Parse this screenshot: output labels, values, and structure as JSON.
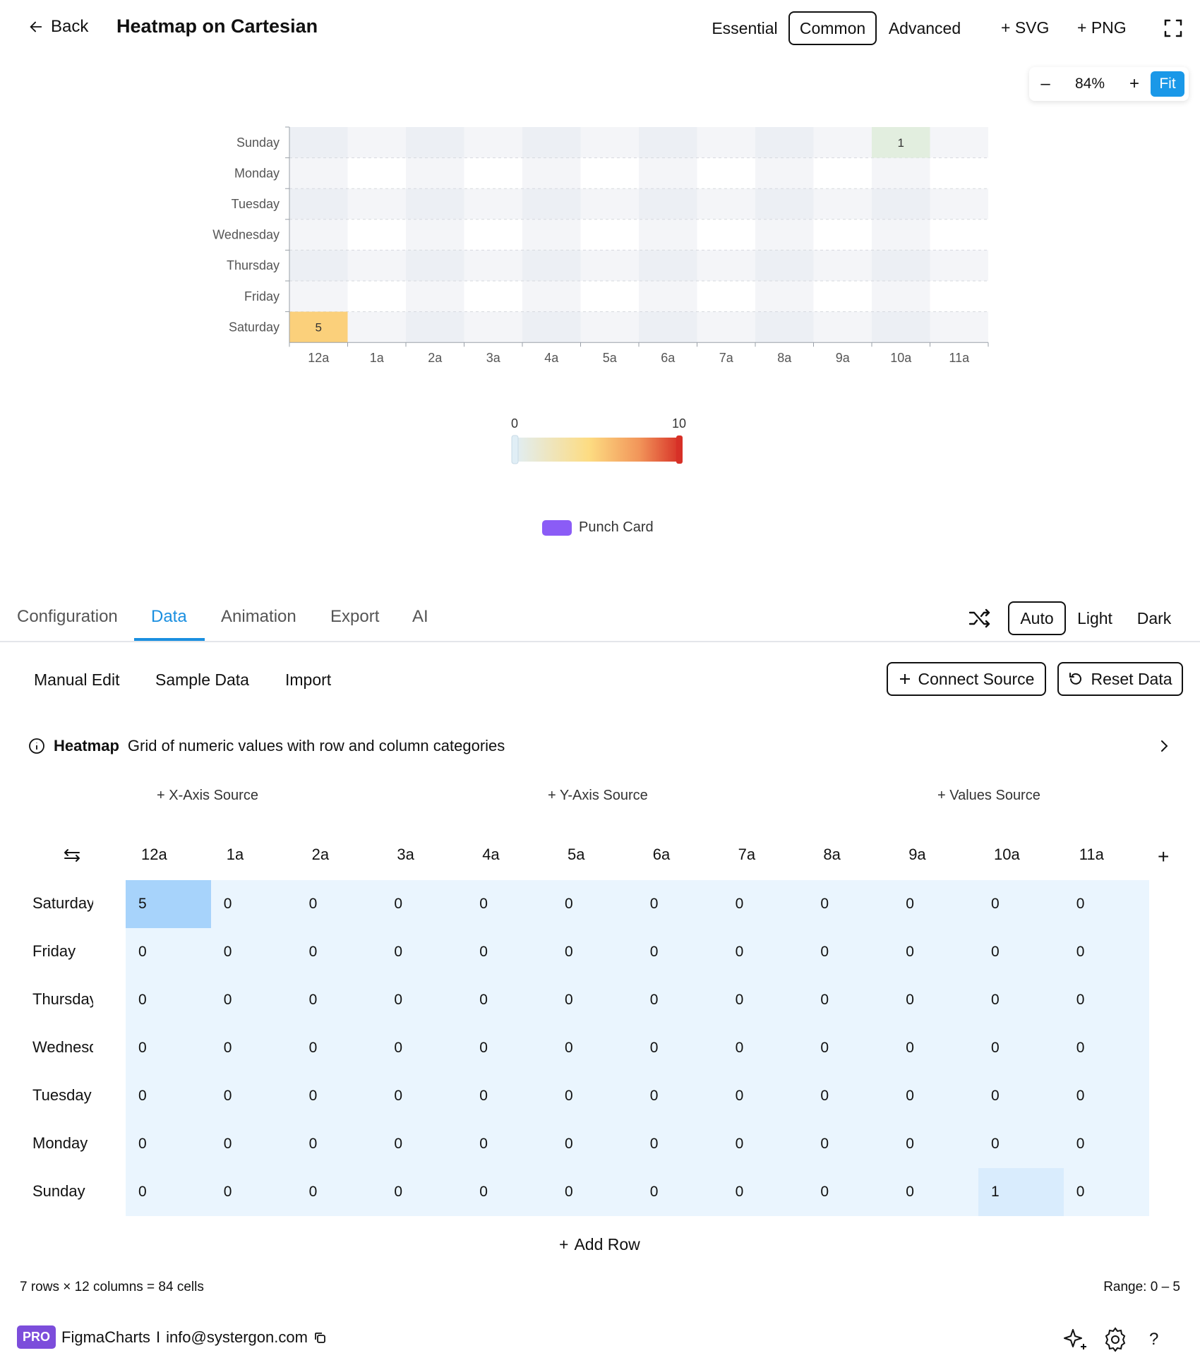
{
  "header": {
    "back_label": "Back",
    "title": "Heatmap on Cartesian",
    "levels": [
      "Essential",
      "Common",
      "Advanced"
    ],
    "active_level": "Common",
    "export_svg": "+ SVG",
    "export_png": "+ PNG"
  },
  "zoom": {
    "minus": "–",
    "value": "84%",
    "plus": "+",
    "fit_label": "Fit"
  },
  "chart_data": {
    "type": "heatmap",
    "x_categories": [
      "12a",
      "1a",
      "2a",
      "3a",
      "4a",
      "5a",
      "6a",
      "7a",
      "8a",
      "9a",
      "10a",
      "11a"
    ],
    "y_categories": [
      "Sunday",
      "Monday",
      "Tuesday",
      "Wednesday",
      "Thursday",
      "Friday",
      "Saturday"
    ],
    "values": [
      [
        0,
        0,
        0,
        0,
        0,
        0,
        0,
        0,
        0,
        0,
        1,
        0
      ],
      [
        0,
        0,
        0,
        0,
        0,
        0,
        0,
        0,
        0,
        0,
        0,
        0
      ],
      [
        0,
        0,
        0,
        0,
        0,
        0,
        0,
        0,
        0,
        0,
        0,
        0
      ],
      [
        0,
        0,
        0,
        0,
        0,
        0,
        0,
        0,
        0,
        0,
        0,
        0
      ],
      [
        0,
        0,
        0,
        0,
        0,
        0,
        0,
        0,
        0,
        0,
        0,
        0
      ],
      [
        0,
        0,
        0,
        0,
        0,
        0,
        0,
        0,
        0,
        0,
        0,
        0
      ],
      [
        5,
        0,
        0,
        0,
        0,
        0,
        0,
        0,
        0,
        0,
        0,
        0
      ]
    ],
    "visual_map": {
      "min": 0,
      "max": 10,
      "min_label": "0",
      "max_label": "10"
    },
    "series_name": "Punch Card",
    "series_color": "#8b5cf6"
  },
  "tabs": [
    "Configuration",
    "Data",
    "Animation",
    "Export",
    "AI"
  ],
  "active_tab": "Data",
  "themes": [
    "Auto",
    "Light",
    "Dark"
  ],
  "active_theme": "Auto",
  "data_panel": {
    "subtabs": [
      "Manual Edit",
      "Sample Data",
      "Import"
    ],
    "connect_source": "Connect Source",
    "reset_data": "Reset Data",
    "info_title": "Heatmap",
    "info_desc": "Grid of numeric values with row and column categories",
    "x_source": "X-Axis Source",
    "y_source": "Y-Axis Source",
    "values_source": "Values Source",
    "columns": [
      "12a",
      "1a",
      "2a",
      "3a",
      "4a",
      "5a",
      "6a",
      "7a",
      "8a",
      "9a",
      "10a",
      "11a"
    ],
    "rows": [
      {
        "label": "Saturday",
        "values": [
          "5",
          "0",
          "0",
          "0",
          "0",
          "0",
          "0",
          "0",
          "0",
          "0",
          "0",
          "0"
        ]
      },
      {
        "label": "Friday",
        "values": [
          "0",
          "0",
          "0",
          "0",
          "0",
          "0",
          "0",
          "0",
          "0",
          "0",
          "0",
          "0"
        ]
      },
      {
        "label": "Thursday",
        "values": [
          "0",
          "0",
          "0",
          "0",
          "0",
          "0",
          "0",
          "0",
          "0",
          "0",
          "0",
          "0"
        ]
      },
      {
        "label": "Wednesday",
        "values": [
          "0",
          "0",
          "0",
          "0",
          "0",
          "0",
          "0",
          "0",
          "0",
          "0",
          "0",
          "0"
        ]
      },
      {
        "label": "Tuesday",
        "values": [
          "0",
          "0",
          "0",
          "0",
          "0",
          "0",
          "0",
          "0",
          "0",
          "0",
          "0",
          "0"
        ]
      },
      {
        "label": "Monday",
        "values": [
          "0",
          "0",
          "0",
          "0",
          "0",
          "0",
          "0",
          "0",
          "0",
          "0",
          "0",
          "0"
        ]
      },
      {
        "label": "Sunday",
        "values": [
          "0",
          "0",
          "0",
          "0",
          "0",
          "0",
          "0",
          "0",
          "0",
          "0",
          "1",
          "0"
        ]
      }
    ],
    "add_row": "Add Row",
    "stats": "7 rows × 12 columns = 84 cells",
    "range": "Range: 0 – 5"
  },
  "footer": {
    "badge": "PRO",
    "brand": "FigmaCharts",
    "separator": "I",
    "email": "info@systergon.com",
    "help": "?"
  },
  "colors": {
    "accent": "#1a8fe0",
    "fit_button": "#1a98e8",
    "pro_badge": "#7c4ddb",
    "cell_bg": "#eaf5fe",
    "cell_selected": "#a7d3fb",
    "cell_highlight": "#d9ecfd"
  }
}
